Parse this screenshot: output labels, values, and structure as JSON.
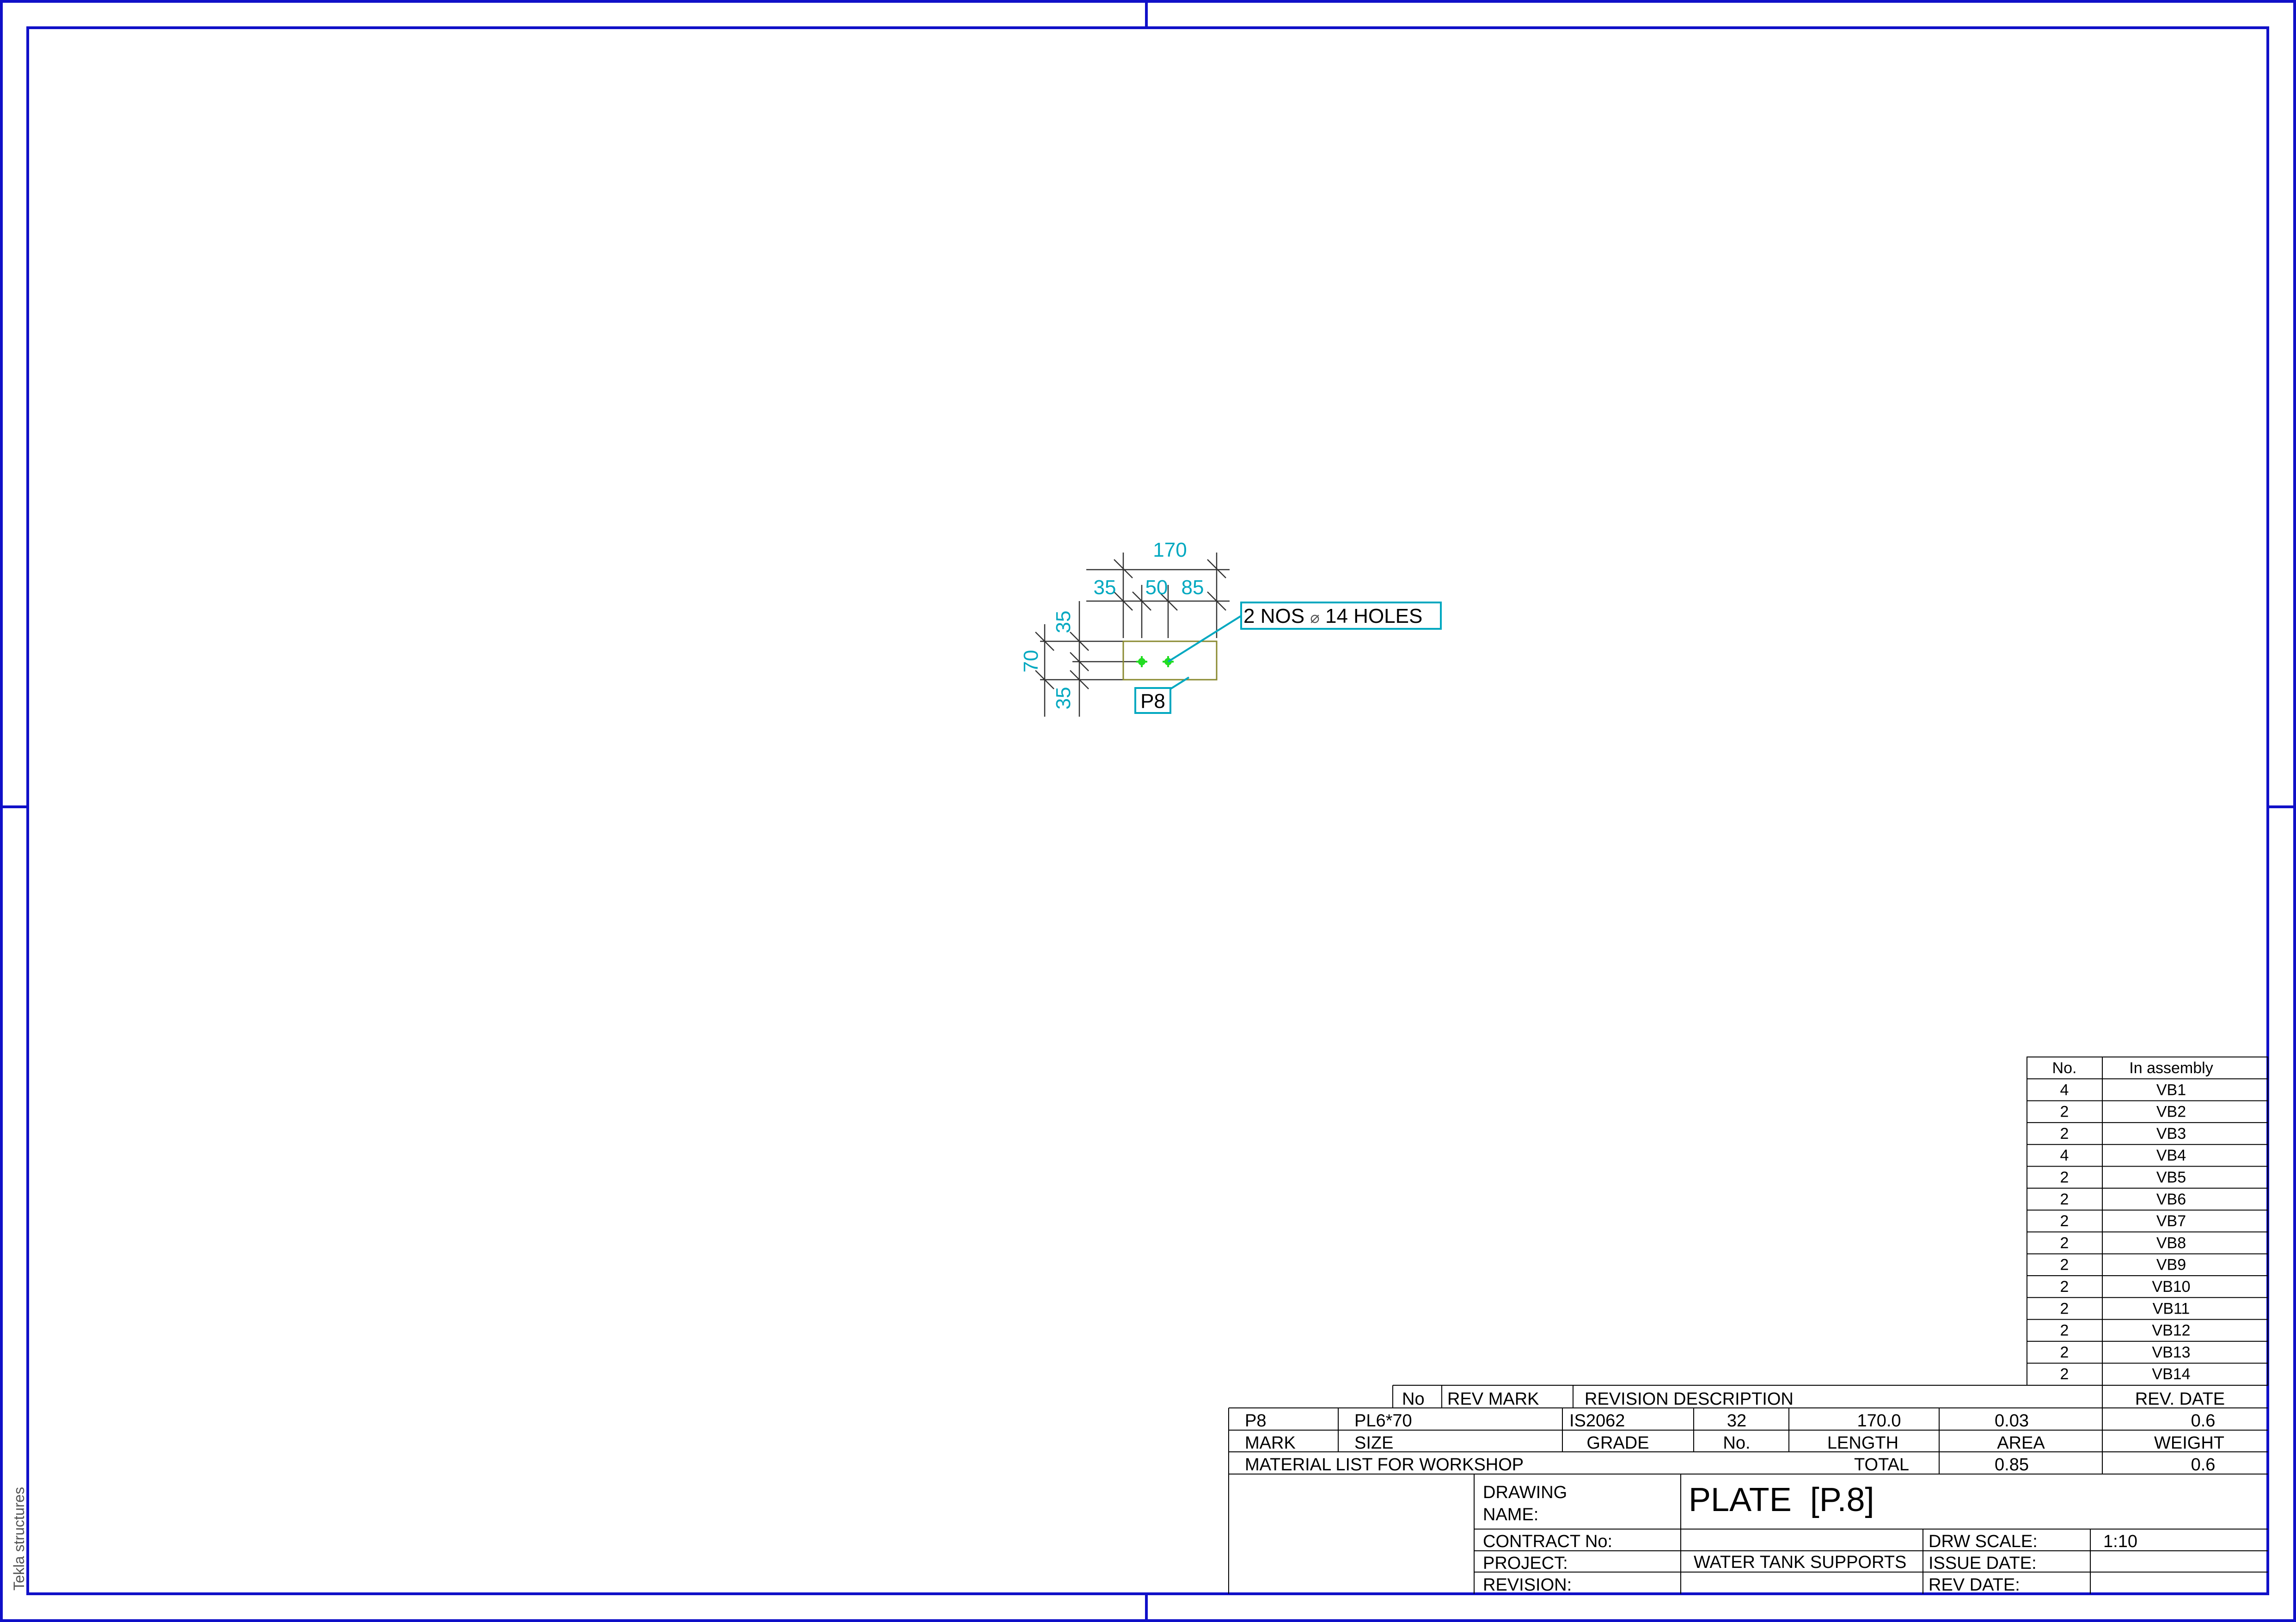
{
  "sheet": {
    "side_label": "Tekla structures"
  },
  "drawing": {
    "dimensions": {
      "overall": "170",
      "seg1": "35",
      "seg2": "50",
      "seg3": "85",
      "vert_top": "35",
      "vert_total": "70",
      "vert_bottom": "35"
    },
    "hole_label_prefix": "2 NOS",
    "hole_label_symbol": "⌀",
    "hole_label_suffix": "14 HOLES",
    "part_mark": "P8"
  },
  "assembly_table": {
    "headers": [
      "No.",
      "In assembly"
    ],
    "rows": [
      [
        "4",
        "VB1"
      ],
      [
        "2",
        "VB2"
      ],
      [
        "2",
        "VB3"
      ],
      [
        "4",
        "VB4"
      ],
      [
        "2",
        "VB5"
      ],
      [
        "2",
        "VB6"
      ],
      [
        "2",
        "VB7"
      ],
      [
        "2",
        "VB8"
      ],
      [
        "2",
        "VB9"
      ],
      [
        "2",
        "VB10"
      ],
      [
        "2",
        "VB11"
      ],
      [
        "2",
        "VB12"
      ],
      [
        "2",
        "VB13"
      ],
      [
        "2",
        "VB14"
      ]
    ]
  },
  "revision_header": {
    "no": "No",
    "mark": "REV MARK",
    "desc": "REVISION DESCRIPTION",
    "date": "REV. DATE"
  },
  "material_row": {
    "mark": "P8",
    "size": "PL6*70",
    "grade": "IS2062",
    "no": "32",
    "length": "170.0",
    "area": "0.03",
    "weight": "0.6"
  },
  "material_header": {
    "mark": "MARK",
    "size": "SIZE",
    "grade": "GRADE",
    "no": "No.",
    "length": "LENGTH",
    "area": "AREA",
    "weight": "WEIGHT"
  },
  "material_total": {
    "label": "MATERIAL LIST FOR WORKSHOP",
    "total_label": "TOTAL",
    "area": "0.85",
    "weight": "0.6"
  },
  "title_block": {
    "drawing_label_1": "DRAWING",
    "drawing_label_2": "NAME:",
    "drawing_name": "PLATE  [P.8]",
    "contract_label": "CONTRACT No:",
    "project_label": "PROJECT:",
    "project_value": "WATER TANK SUPPORTS",
    "revision_label": "REVISION:",
    "scale_label": "DRW SCALE:",
    "scale_value": "1:10",
    "issue_label": "ISSUE DATE:",
    "revdate_label": "REV DATE:"
  },
  "colors": {
    "frame": "#1010c8",
    "dimension": "#00a8c0",
    "outline": "#8a8a30",
    "hole": "#22dd22",
    "line": "#000000"
  }
}
